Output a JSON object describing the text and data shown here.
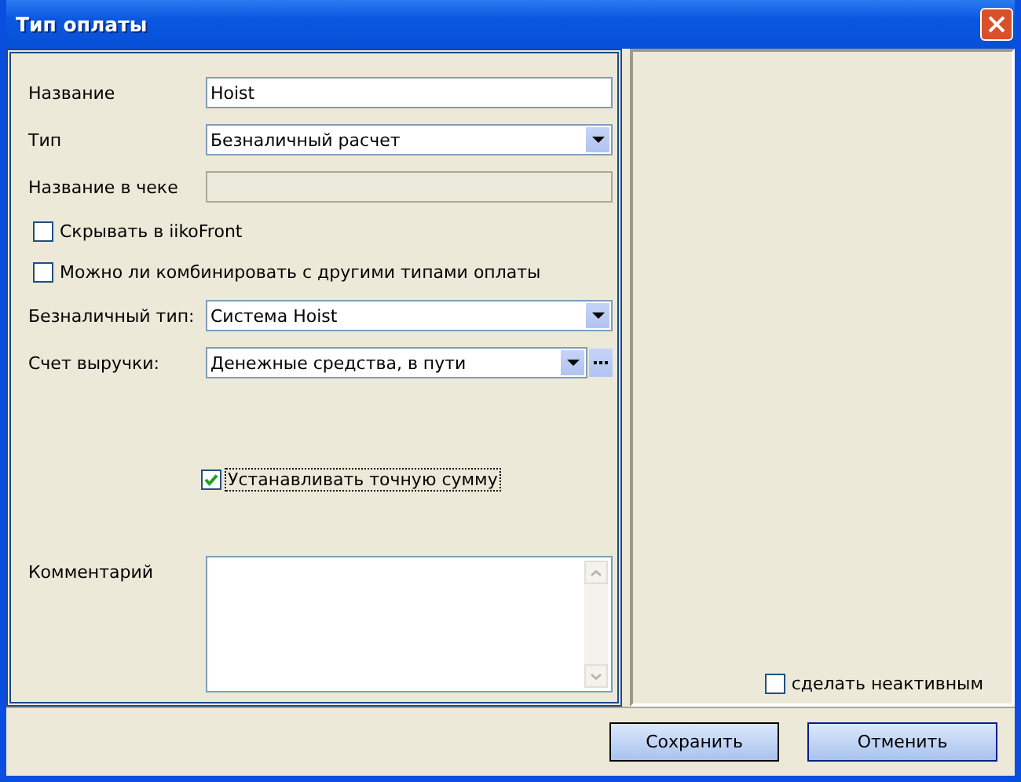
{
  "window": {
    "title": "Тип оплаты"
  },
  "form": [
    {
      "kind": "text",
      "label": "Название",
      "value": "Hoist",
      "disabled": false
    },
    {
      "kind": "dropdown",
      "label": "Тип",
      "value": "Безналичный расчет",
      "browse_button": false
    },
    {
      "kind": "text",
      "label": "Название в чеке",
      "disabled": true
    },
    {
      "kind": "checkbox",
      "label": "Скрывать в iikoFront",
      "checked": false
    },
    {
      "kind": "checkbox",
      "label": "Можно ли комбинировать с другими типами оплаты",
      "checked": false
    },
    {
      "kind": "dropdown",
      "label": "Безналичный тип:",
      "value": "Система Hoist",
      "browse_button": false
    },
    {
      "kind": "dropdown",
      "label": "Счет выручки:",
      "value": "Денежные средства, в пути",
      "browse_button": true
    }
  ],
  "exact_sum_checkbox": {
    "label": "Устанавливать точную сумму",
    "checked": true,
    "focused": true
  },
  "comment": {
    "label": "Комментарий"
  },
  "inactive_checkbox": {
    "label": "сделать неактивным",
    "checked": false
  },
  "buttons": [
    "Сохранить",
    "Отменить"
  ]
}
